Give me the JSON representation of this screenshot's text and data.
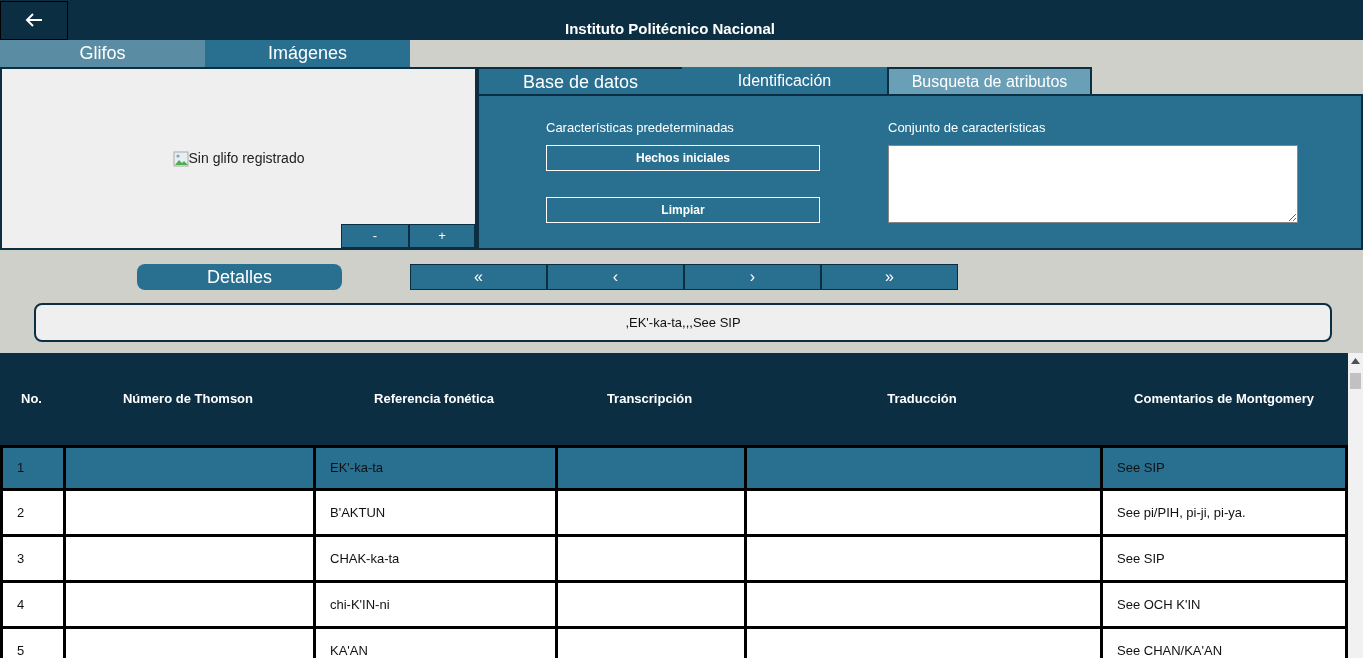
{
  "header": {
    "title": "Instituto Politécnico Nacional"
  },
  "view_tabs": [
    {
      "label": "Glifos",
      "selected": true
    },
    {
      "label": "Imágenes",
      "selected": false
    }
  ],
  "glyph_viewer": {
    "alt_text": "Sin glifo registrado",
    "zoom_out": "-",
    "zoom_in": "+"
  },
  "panel_tabs": [
    {
      "label": "Base de datos",
      "selected": false,
      "large": true
    },
    {
      "label": "Identificación",
      "selected": false,
      "large": false
    },
    {
      "label": "Busqueta de atributos",
      "selected": true,
      "large": false
    }
  ],
  "attribute_search": {
    "defaults_label": "Características predeterminadas",
    "buttons": [
      "Hechos iniciales",
      "Limpiar"
    ],
    "set_label": "Conjunto de características"
  },
  "details_button": "Detalles",
  "pager": [
    "«",
    "‹",
    "›",
    "»"
  ],
  "detail_text": ",EK'-ka-ta,,,See SIP",
  "table": {
    "columns": [
      "No.",
      "Número de Thomson",
      "Referencia fonética",
      "Transcripción",
      "Traducción",
      "Comentarios de Montgomery"
    ],
    "rows": [
      {
        "selected": true,
        "cells": [
          "1",
          "",
          "EK'-ka-ta",
          "",
          "",
          "See SIP"
        ]
      },
      {
        "selected": false,
        "cells": [
          "2",
          "",
          "B'AKTUN",
          "",
          "",
          "See pi/PIH, pi-ji, pi-ya."
        ]
      },
      {
        "selected": false,
        "cells": [
          "3",
          "",
          "CHAK-ka-ta",
          "",
          "",
          "See SIP"
        ]
      },
      {
        "selected": false,
        "cells": [
          "4",
          "",
          "chi-K'IN-ni",
          "",
          "",
          "See OCH K'IN"
        ]
      },
      {
        "selected": false,
        "cells": [
          "5",
          "",
          "KA'AN",
          "",
          "",
          "See CHAN/KA'AN"
        ]
      }
    ]
  }
}
